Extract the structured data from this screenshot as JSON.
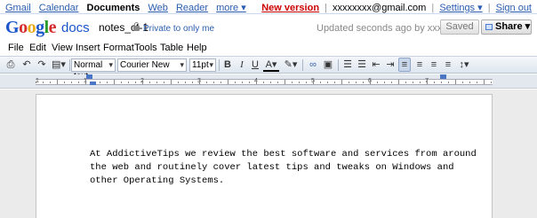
{
  "gbar": {
    "links": [
      "Gmail",
      "Calendar",
      "Documents",
      "Web",
      "Reader",
      "more ▾"
    ],
    "new_version": "New version",
    "account": "xxxxxxxx@gmail.com",
    "settings": "Settings ▾",
    "sign_out": "Sign out"
  },
  "header": {
    "docs_word": "docs",
    "doc_title": "notes_ct-1",
    "privacy": "Private to only me",
    "updated": "Updated seconds ago by xxxxxxx",
    "saved_button": "Saved",
    "share_button": "Share ▾"
  },
  "menu": [
    "File",
    "Edit",
    "View",
    "Insert",
    "Format",
    "Tools",
    "Table",
    "Help"
  ],
  "toolbar": {
    "style": "Normal text",
    "font": "Courier New",
    "size": "11pt",
    "bold": "B",
    "italic": "I",
    "underline": "U",
    "text_color": "A"
  },
  "ruler": {
    "numbers": [
      "1",
      "1",
      "2",
      "3",
      "4",
      "5",
      "6",
      "7"
    ]
  },
  "document": {
    "lines": [
      "At AddictiveTips we review the best software and services from around",
      "the web and routinely cover latest tips and tweaks on Windows and",
      "other Operating Systems."
    ]
  },
  "colors": {
    "link": "#2a5db0",
    "new_version": "#cc0000",
    "ruler_marker": "#4a76c5"
  }
}
